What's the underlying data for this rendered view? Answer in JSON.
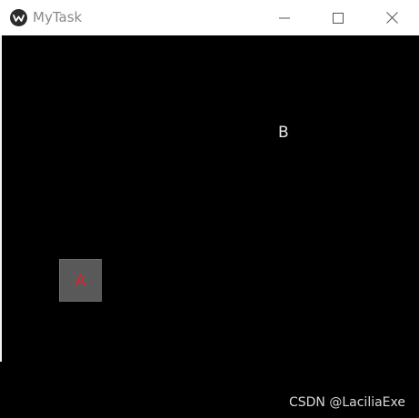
{
  "window": {
    "title": "MyTask",
    "icon": "app-logo-icon",
    "controls": {
      "minimize_icon": "minimize-icon",
      "maximize_icon": "maximize-icon",
      "close_icon": "close-icon"
    }
  },
  "canvas": {
    "background": "#000000",
    "widget_a_label": "A",
    "widget_a_color": "#d9242a",
    "label_b": "B"
  },
  "watermark": {
    "text": "CSDN @LaciliaExe"
  }
}
